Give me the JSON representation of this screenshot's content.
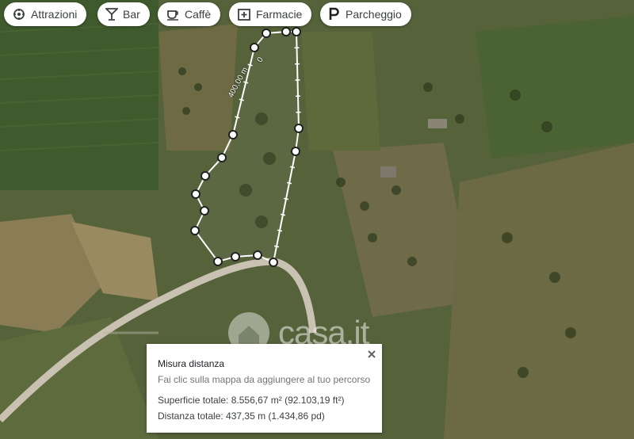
{
  "chips": [
    {
      "label": "Attrazioni",
      "icon": "attractions-icon"
    },
    {
      "label": "Bar",
      "icon": "cocktail-icon"
    },
    {
      "label": "Caffè",
      "icon": "coffee-cup-icon"
    },
    {
      "label": "Farmacie",
      "icon": "pharmacy-icon"
    },
    {
      "label": "Parcheggio",
      "icon": "parking-icon"
    }
  ],
  "measure": {
    "title": "Misura distanza",
    "hint": "Fai clic sulla mappa da aggiungere al tuo percorso",
    "area": "Superficie totale: 8.556,67 m² (92.103,19 ft²)",
    "distance": "Distanza totale: 437,35 m (1.434,86 pd)",
    "segment_label": "400,00 m",
    "start_label": "0"
  },
  "watermark": "casa.it",
  "colors": {
    "route": "#ffffff",
    "field_dark": "#3f4d2a",
    "road": "#c9c2b3"
  }
}
